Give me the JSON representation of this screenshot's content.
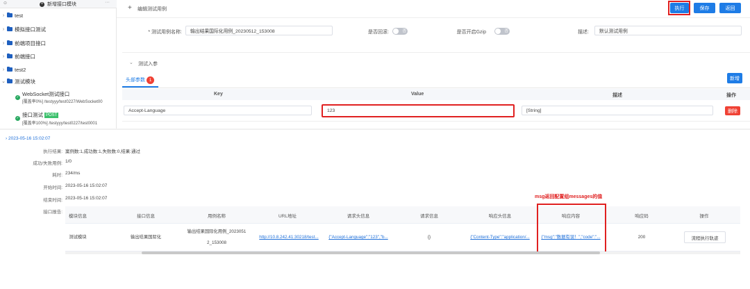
{
  "sidebar": {
    "add_module_label": "新增接口模块",
    "more": "···",
    "items": [
      {
        "label": "test"
      },
      {
        "label": "模拟接口测试"
      },
      {
        "label": "前端项目接口"
      },
      {
        "label": "前端接口"
      },
      {
        "label": "test2"
      },
      {
        "label": "测试模块"
      }
    ],
    "cases": [
      {
        "name": "WebSocket测试接口",
        "detail": "[覆盖率0%] /testyyy/test0227/WebSocket00"
      },
      {
        "name": "接口测试",
        "method": "POST",
        "detail": "[覆盖率100%] /testyyy/test0227/test0001"
      }
    ]
  },
  "header": {
    "title": "编辑测试用例",
    "buttons": {
      "run": "执行",
      "save": "保存",
      "back": "返回"
    }
  },
  "form": {
    "name_label": "* 测试用例名称:",
    "name_value": "输出结果国际化用例_20230512_153008",
    "rollback_label": "是否回滚:",
    "rollback_value": "否",
    "gzip_label": "是否开启Gzip",
    "gzip_value": "否",
    "desc_label": "描述:",
    "desc_value": "默认测试用例"
  },
  "params": {
    "section_title": "测试入参",
    "tab_label": "头部参数",
    "tab_badge": "1",
    "add_button": "新增",
    "columns": [
      "Key",
      "Value",
      "描述",
      "操作"
    ],
    "row": {
      "key": "Accept-Language",
      "value": "123",
      "desc": "[String]",
      "delete": "删除"
    }
  },
  "result": {
    "timestamp": "2023-05-16 15:02:07",
    "fields": [
      {
        "label": "执行结果:",
        "value": "案例数:1,成功数:1,失败数:0,结果:通过"
      },
      {
        "label": "成功/失败用例:",
        "value": "1/0"
      },
      {
        "label": "耗时:",
        "value": "234/ms"
      },
      {
        "label": "开始时间:",
        "value": "2023-05-16 15:02:07"
      },
      {
        "label": "结束时间:",
        "value": "2023-05-16 15:02:07"
      },
      {
        "label": "接口报告:",
        "value": ""
      }
    ],
    "annotation": "msg返回配置组messages的值",
    "table": {
      "columns": [
        "模块信息",
        "接口信息",
        "用例名称",
        "URL地址",
        "请求头信息",
        "请求信息",
        "响应头信息",
        "响应内容",
        "响应码",
        "操作"
      ],
      "row": {
        "module": "测试模块",
        "api": "输出结果国际化",
        "case_line1": "输出结果国际化用例_2023051",
        "case_line2": "2_153008",
        "url": "http://10.8.242.41:30218/test...",
        "req_headers": "{\"Accept-Language\":\"123\",\"b...",
        "req_info": "{}",
        "resp_headers": "{\"Content-Type\":\"application/...",
        "resp_body": "{\"msg\":\"数据有误！\",\"code\":\"...",
        "status": "200",
        "action": "流程执行轨迹"
      }
    }
  },
  "colors": {
    "primary": "#1e7ce6",
    "danger": "#f04134",
    "highlight": "#e02020",
    "folder": "#1e5fbf"
  }
}
